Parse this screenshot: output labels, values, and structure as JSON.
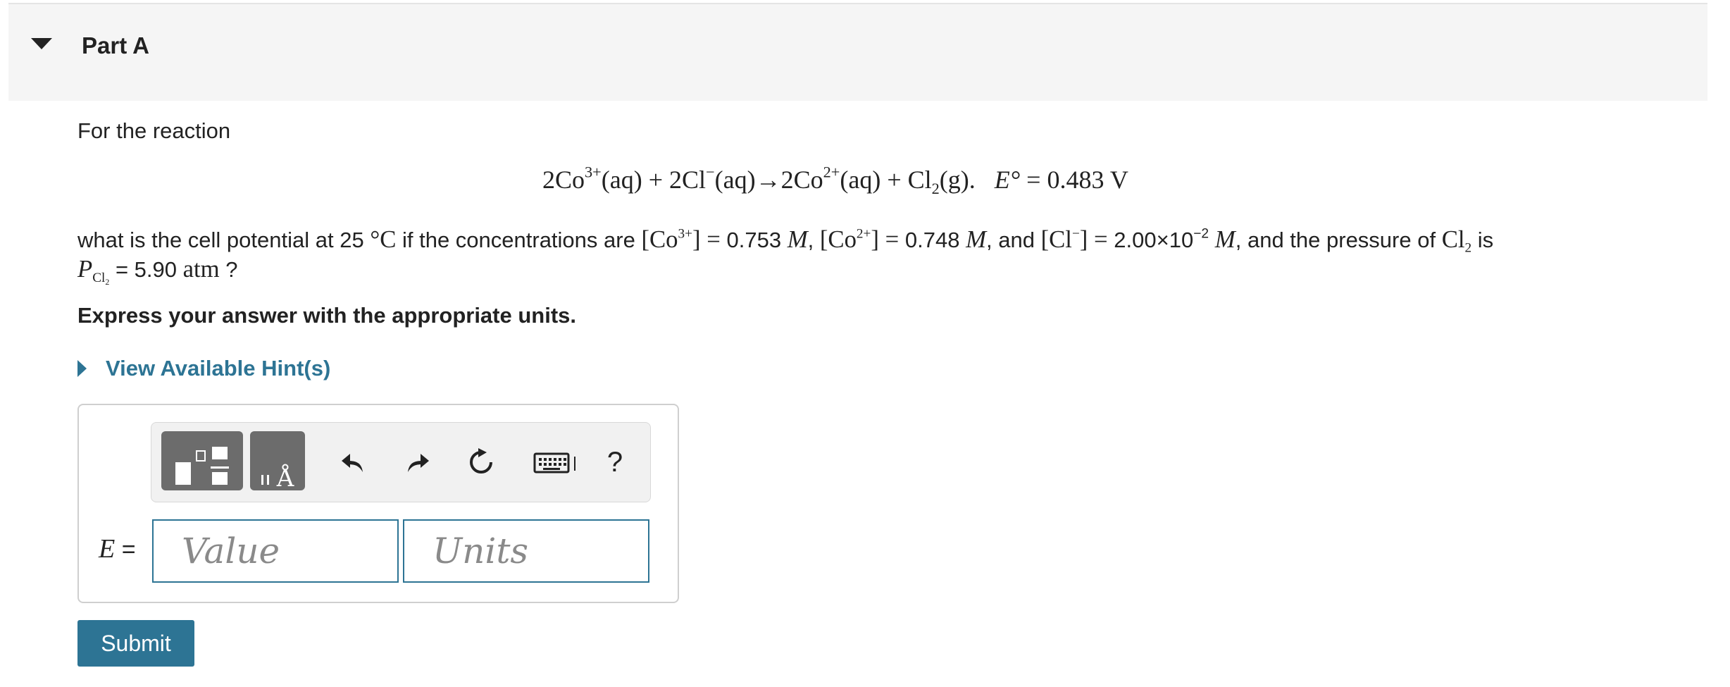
{
  "part": {
    "title": "Part A"
  },
  "question": {
    "intro": "For the reaction",
    "equation": {
      "r1_coef": "2Co",
      "r1_charge": "3+",
      "r1_state": "(aq) + 2Cl",
      "r2_charge": "−",
      "r2_state": "(aq)→2Co",
      "p1_charge": "2+",
      "p1_state": "(aq) + Cl",
      "p2_sub": "2",
      "p2_state": "(g).",
      "e_symbol": "E°",
      "e_value": " = 0.483 V"
    },
    "line1": {
      "a": "what is the cell potential at 25 ",
      "deg": "°C",
      "b": " if the concentrations are ",
      "co3_open": "[Co",
      "co3_charge": "3+",
      "co3_close": "] = ",
      "co3_val": "0.753 ",
      "m1": "M",
      "sep1": ", ",
      "co2_open": "[Co",
      "co2_charge": "2+",
      "co2_close": "] = ",
      "co2_val": "0.748 ",
      "m2": "M",
      "sep2": ", and ",
      "cl_open": "[Cl",
      "cl_charge": "−",
      "cl_close": "] = ",
      "cl_val": "2.00×10",
      "cl_exp": "−2",
      "m3": " M",
      "c": ", and the pressure of ",
      "cl2": "Cl",
      "cl2_sub": "2",
      "d": " is"
    },
    "line2": {
      "p": "P",
      "p_sub": "Cl",
      "p_sub2": "2",
      "eq": " = 5.90 ",
      "atm": "atm",
      "end": " ?"
    },
    "instruction": "Express your answer with the appropriate units."
  },
  "hints": {
    "label": "View Available Hint(s)"
  },
  "answer": {
    "label_var": "E",
    "label_eq": " =",
    "value_placeholder": "Value",
    "units_placeholder": "Units",
    "toolbar": {
      "template1_icon": "fraction-template-icon",
      "template2_icon": "units-template-icon",
      "template2_glyph": "Å",
      "undo_icon": "undo-icon",
      "redo_icon": "redo-icon",
      "reset_icon": "reset-icon",
      "keyboard_icon": "keyboard-icon",
      "help_label": "?"
    }
  },
  "submit": {
    "label": "Submit"
  },
  "colors": {
    "accent": "#2d7494",
    "header_bg": "#f5f5f5",
    "tool_dark": "#6c6c6c"
  }
}
